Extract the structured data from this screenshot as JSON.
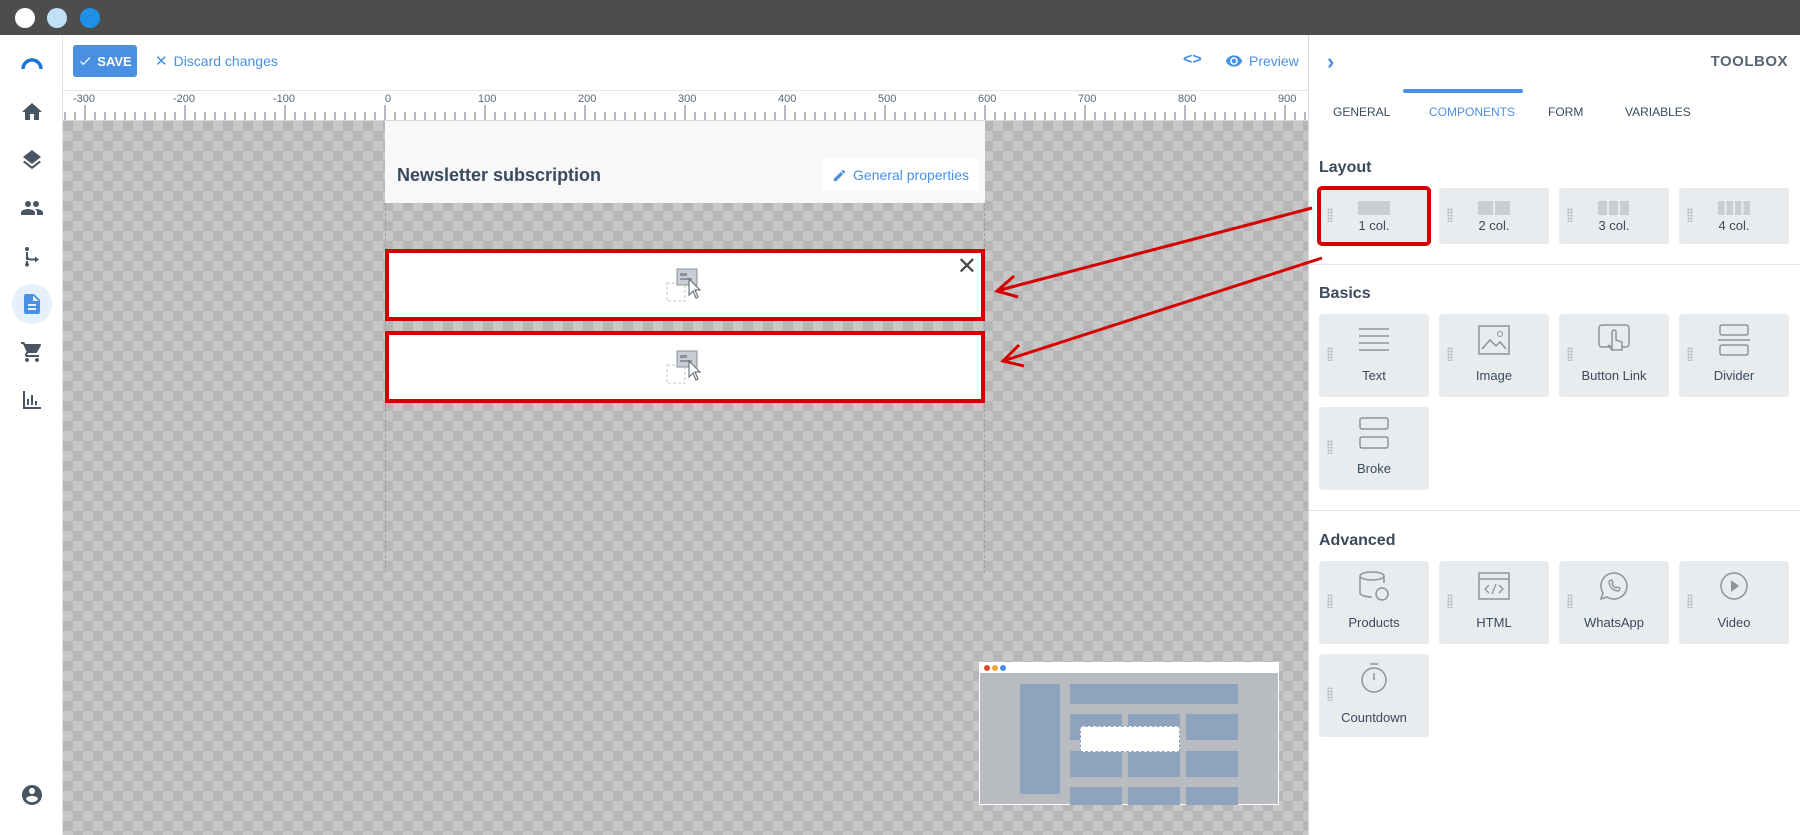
{
  "window": {
    "dots": [
      "#ffffff",
      "#bfe0f7",
      "#1e90e6"
    ]
  },
  "nav": {
    "items": [
      {
        "icon": "logo-icon"
      },
      {
        "icon": "home-icon"
      },
      {
        "icon": "layers-icon"
      },
      {
        "icon": "people-icon"
      },
      {
        "icon": "flow-icon"
      },
      {
        "icon": "document-icon"
      },
      {
        "icon": "cart-icon"
      },
      {
        "icon": "chart-icon"
      },
      {
        "icon": "account-icon"
      }
    ]
  },
  "toolbar": {
    "save_label": "SAVE",
    "discard_label": "Discard changes",
    "code_label": "<>",
    "preview_label": "Preview"
  },
  "ruler": {
    "labels": [
      "-300",
      "-200",
      "-100",
      "0",
      "100",
      "200",
      "300",
      "400",
      "500",
      "600",
      "700",
      "800",
      "900"
    ]
  },
  "canvas": {
    "title": "Newsletter subscription",
    "general_properties_label": "General properties",
    "close_label": "✕"
  },
  "panel": {
    "title": "TOOLBOX",
    "chevron": "›",
    "tabs": [
      "GENERAL",
      "COMPONENTS",
      "FORM",
      "VARIABLES"
    ],
    "active_tab": "COMPONENTS",
    "sections": {
      "layout": {
        "title": "Layout",
        "items": [
          "1 col.",
          "2 col.",
          "3 col.",
          "4 col."
        ]
      },
      "basics": {
        "title": "Basics",
        "items": [
          "Text",
          "Image",
          "Button Link",
          "Divider",
          "Broke"
        ]
      },
      "advanced": {
        "title": "Advanced",
        "items": [
          "Products",
          "HTML",
          "WhatsApp",
          "Video",
          "Countdown"
        ]
      }
    }
  },
  "colors": {
    "accent": "#4a90e2",
    "highlight": "#d50000"
  }
}
